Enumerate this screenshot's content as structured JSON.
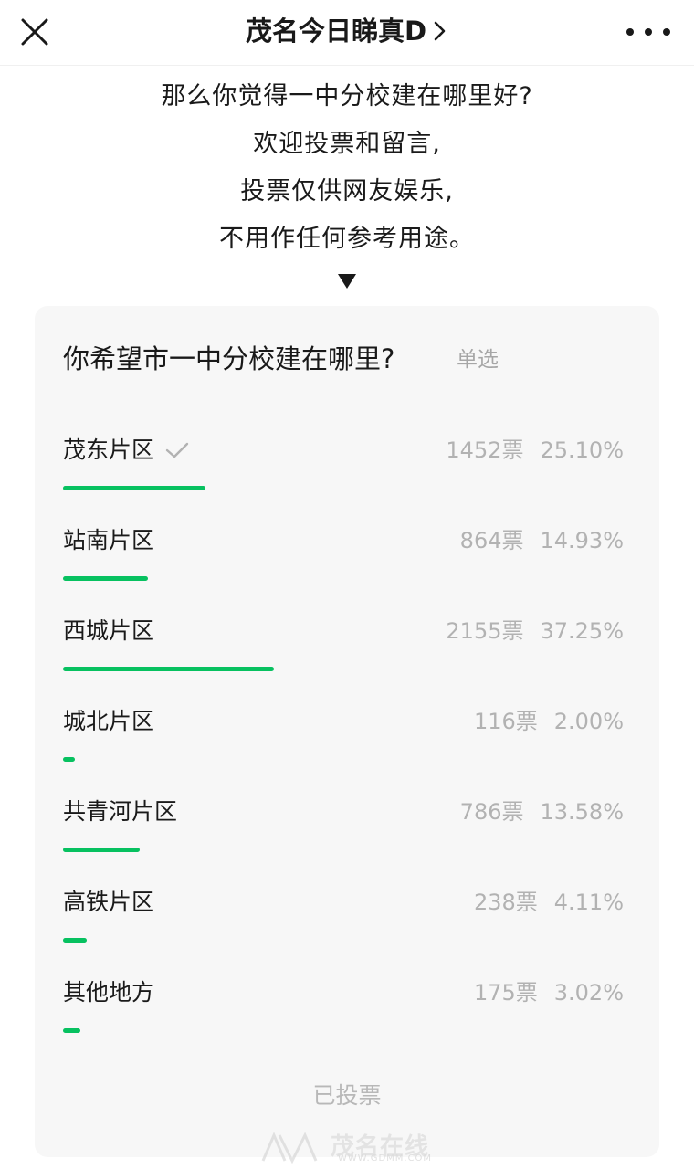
{
  "header": {
    "title": "茂名今日睇真D",
    "close_icon": "close-icon",
    "more_icon": "more-icon"
  },
  "intro": {
    "lines": [
      "那么你觉得一中分校建在哪里好?",
      "欢迎投票和留言,",
      "投票仅供网友娱乐,",
      "不用作任何参考用途。"
    ],
    "arrow": "▼"
  },
  "poll": {
    "question": "你希望市一中分校建在哪里?",
    "type": "单选",
    "accent": "#07c160",
    "options": [
      {
        "label": "茂东片区",
        "votes": "1452票",
        "percent": "25.10%",
        "share": 0.251,
        "selected": true
      },
      {
        "label": "站南片区",
        "votes": "864票",
        "percent": "14.93%",
        "share": 0.1493,
        "selected": false
      },
      {
        "label": "西城片区",
        "votes": "2155票",
        "percent": "37.25%",
        "share": 0.3725,
        "selected": false
      },
      {
        "label": "城北片区",
        "votes": "116票",
        "percent": "2.00%",
        "share": 0.02,
        "selected": false
      },
      {
        "label": "共青河片区",
        "votes": "786票",
        "percent": "13.58%",
        "share": 0.1358,
        "selected": false
      },
      {
        "label": "高铁片区",
        "votes": "238票",
        "percent": "4.11%",
        "share": 0.0411,
        "selected": false
      },
      {
        "label": "其他地方",
        "votes": "175票",
        "percent": "3.02%",
        "share": 0.0302,
        "selected": false
      }
    ],
    "status": "已投票"
  },
  "watermark": {
    "text": "茂名在线",
    "url": "WWW.GDMM.COM"
  }
}
